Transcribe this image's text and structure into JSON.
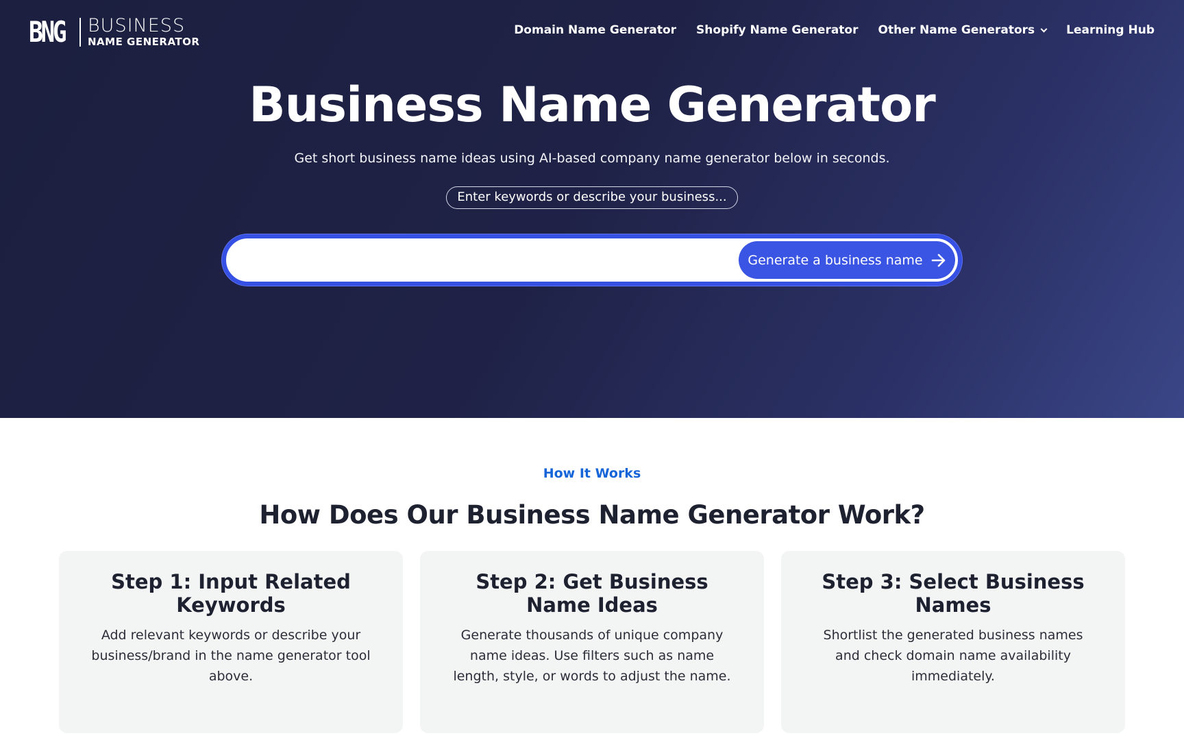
{
  "brand": {
    "mark": "BNG",
    "line1": "BUSINESS",
    "line2": "NAME GENERATOR"
  },
  "nav": {
    "items": [
      {
        "label": "Domain Name Generator"
      },
      {
        "label": "Shopify Name Generator"
      },
      {
        "label": "Other Name Generators"
      },
      {
        "label": "Learning Hub"
      }
    ]
  },
  "hero": {
    "title": "Business Name Generator",
    "subtitle": "Get short business name ideas using AI-based company name generator below in seconds.",
    "hint": "Enter keywords or describe your business...",
    "input_value": "",
    "button_label": "Generate a business name"
  },
  "how_it_works": {
    "kicker": "How It Works",
    "title": "How Does Our Business Name Generator Work?",
    "steps": [
      {
        "title": "Step 1: Input Related Keywords",
        "body": "Add relevant keywords or describe your business/brand in the name generator tool above."
      },
      {
        "title": "Step 2: Get Business Name Ideas",
        "body": "Generate thousands of unique company name ideas. Use filters such as name length, style, or words to adjust the name."
      },
      {
        "title": "Step 3: Select Business Names",
        "body": "Shortlist the generated business names and check domain name availability immediately."
      }
    ]
  },
  "colors": {
    "hero_bg": "#1f2246",
    "accent": "#3a55e4",
    "kicker": "#1565d8",
    "card_bg": "#f3f4f4"
  }
}
